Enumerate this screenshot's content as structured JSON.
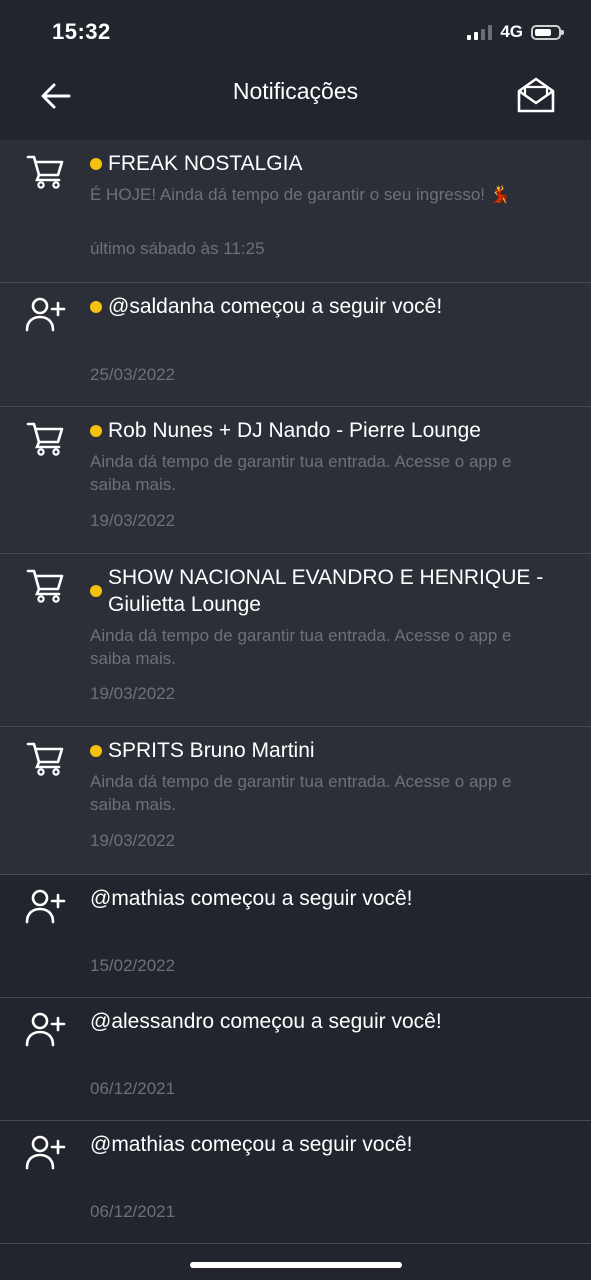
{
  "status_bar": {
    "time": "15:32",
    "network": "4G"
  },
  "header": {
    "title": "Notificações"
  },
  "notifications": [
    {
      "type": "cart",
      "unread": true,
      "title": "FREAK NOSTALGIA",
      "description": "É HOJE! Ainda dá tempo de garantir o seu ingresso! 💃",
      "date": "último sábado às 11:25"
    },
    {
      "type": "follow",
      "unread": true,
      "title": "@saldanha começou a seguir você!",
      "description": "",
      "date": "25/03/2022"
    },
    {
      "type": "cart",
      "unread": true,
      "title": "Rob Nunes + DJ Nando - Pierre Lounge",
      "description": "Ainda dá tempo de garantir tua entrada. Acesse o app e saiba mais.",
      "date": "19/03/2022"
    },
    {
      "type": "cart",
      "unread": true,
      "title": "SHOW NACIONAL EVANDRO E HENRIQUE - Giulietta Lounge",
      "description": "Ainda dá tempo de garantir tua entrada. Acesse o app e saiba mais.",
      "date": "19/03/2022"
    },
    {
      "type": "cart",
      "unread": true,
      "title": "SPRITS Bruno Martini",
      "description": "Ainda dá tempo de garantir tua entrada. Acesse o app e saiba mais.",
      "date": "19/03/2022"
    },
    {
      "type": "follow",
      "unread": false,
      "title": "@mathias começou a seguir você!",
      "description": "",
      "date": "15/02/2022"
    },
    {
      "type": "follow",
      "unread": false,
      "title": "@alessandro começou a seguir você!",
      "description": "",
      "date": "06/12/2021"
    },
    {
      "type": "follow",
      "unread": false,
      "title": "@mathias começou a seguir você!",
      "description": "",
      "date": "06/12/2021"
    }
  ],
  "colors": {
    "background": "#22252d",
    "unread_background": "#2c2f38",
    "unread_dot": "#f4c20d",
    "muted_text": "#6d7079",
    "divider": "#474a52"
  }
}
